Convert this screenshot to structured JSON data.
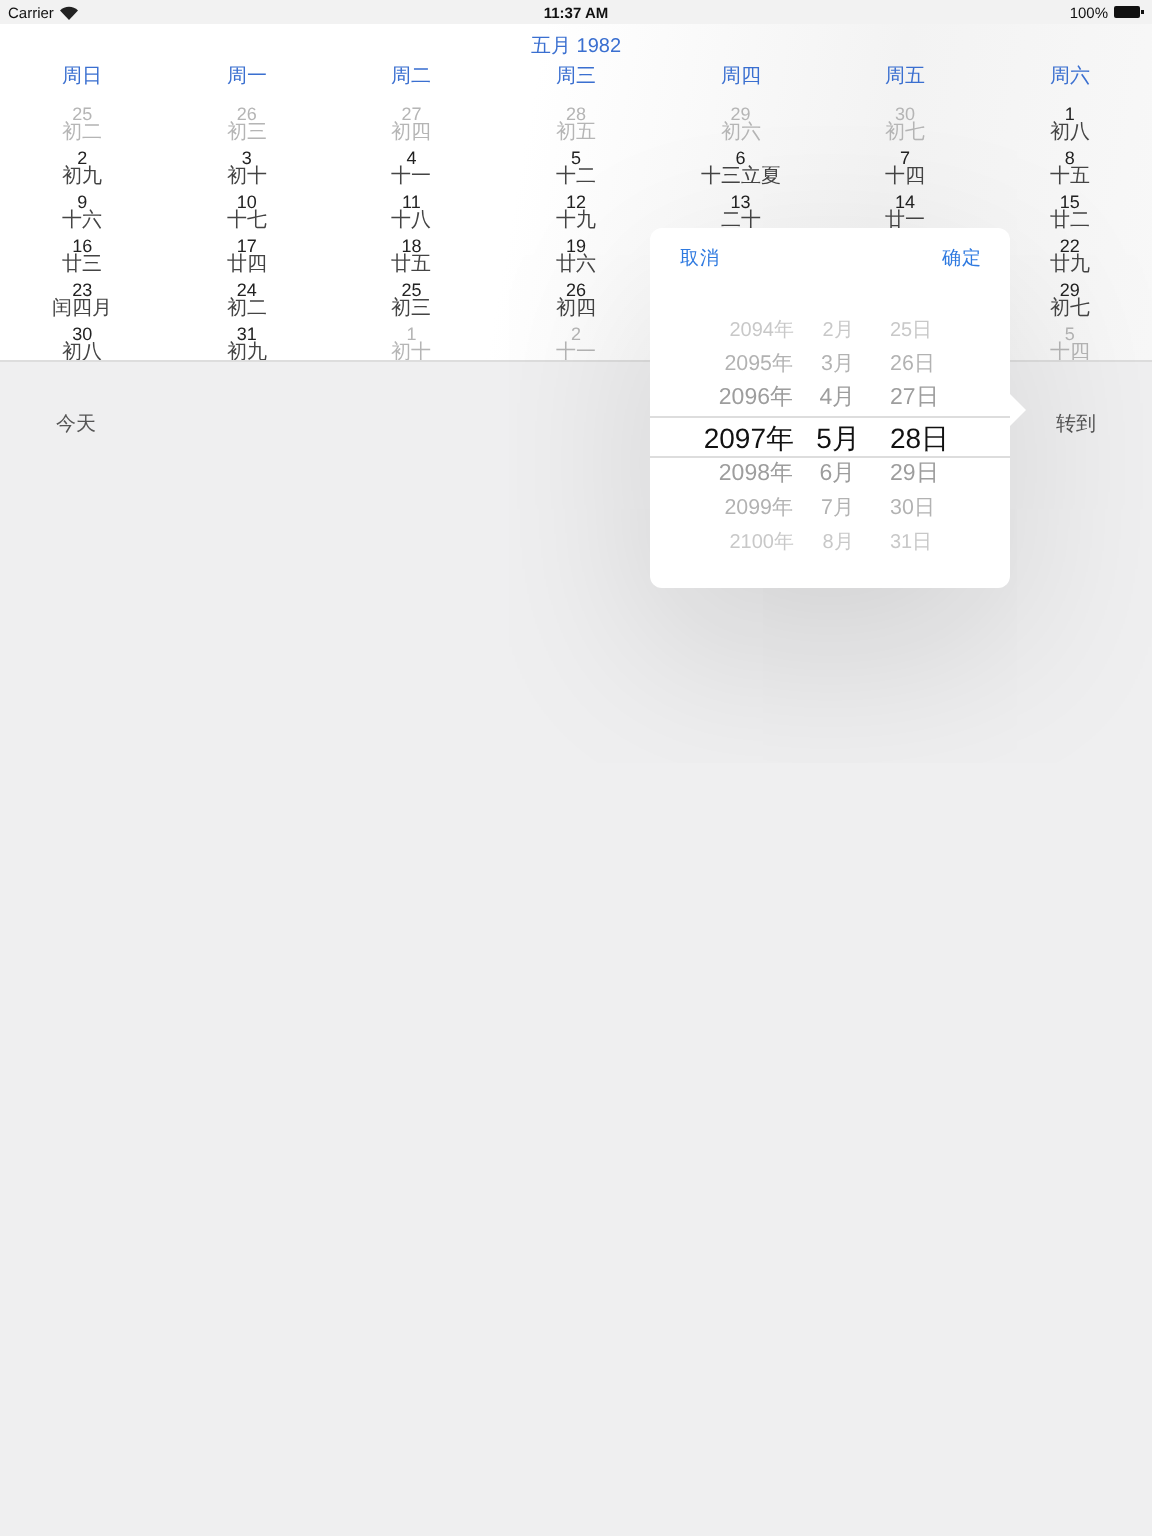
{
  "status_bar": {
    "carrier": "Carrier",
    "time": "11:37 AM",
    "battery": "100%"
  },
  "calendar": {
    "title": "五月 1982",
    "weekdays": [
      "周日",
      "周一",
      "周二",
      "周三",
      "周四",
      "周五",
      "周六"
    ],
    "weeks": [
      [
        {
          "day": "25",
          "lunar": "初二",
          "muted": true
        },
        {
          "day": "26",
          "lunar": "初三",
          "muted": true
        },
        {
          "day": "27",
          "lunar": "初四",
          "muted": true
        },
        {
          "day": "28",
          "lunar": "初五",
          "muted": true
        },
        {
          "day": "29",
          "lunar": "初六",
          "muted": true
        },
        {
          "day": "30",
          "lunar": "初七",
          "muted": true
        },
        {
          "day": "1",
          "lunar": "初八",
          "muted": false
        }
      ],
      [
        {
          "day": "2",
          "lunar": "初九",
          "muted": false
        },
        {
          "day": "3",
          "lunar": "初十",
          "muted": false
        },
        {
          "day": "4",
          "lunar": "十一",
          "muted": false
        },
        {
          "day": "5",
          "lunar": "十二",
          "muted": false
        },
        {
          "day": "6",
          "lunar": "十三立夏",
          "muted": false
        },
        {
          "day": "7",
          "lunar": "十四",
          "muted": false
        },
        {
          "day": "8",
          "lunar": "十五",
          "muted": false
        }
      ],
      [
        {
          "day": "9",
          "lunar": "十六",
          "muted": false
        },
        {
          "day": "10",
          "lunar": "十七",
          "muted": false
        },
        {
          "day": "11",
          "lunar": "十八",
          "muted": false
        },
        {
          "day": "12",
          "lunar": "十九",
          "muted": false
        },
        {
          "day": "13",
          "lunar": "二十",
          "muted": false
        },
        {
          "day": "14",
          "lunar": "廿一",
          "muted": false
        },
        {
          "day": "15",
          "lunar": "廿二",
          "muted": false
        }
      ],
      [
        {
          "day": "16",
          "lunar": "廿三",
          "muted": false
        },
        {
          "day": "17",
          "lunar": "廿四",
          "muted": false
        },
        {
          "day": "18",
          "lunar": "廿五",
          "muted": false
        },
        {
          "day": "19",
          "lunar": "廿六",
          "muted": false
        },
        {
          "day": "22",
          "lunar": "廿九",
          "muted": false
        }
      ],
      [
        {
          "day": "23",
          "lunar": "闰四月",
          "muted": false
        },
        {
          "day": "24",
          "lunar": "初二",
          "muted": false
        },
        {
          "day": "25",
          "lunar": "初三",
          "muted": false
        },
        {
          "day": "26",
          "lunar": "初四",
          "muted": false
        },
        {
          "day": "29",
          "lunar": "初七",
          "muted": false
        }
      ],
      [
        {
          "day": "30",
          "lunar": "初八",
          "muted": false
        },
        {
          "day": "31",
          "lunar": "初九",
          "muted": false
        },
        {
          "day": "1",
          "lunar": "初十",
          "muted": true
        },
        {
          "day": "2",
          "lunar": "十一",
          "muted": true
        },
        {
          "day": "5",
          "lunar": "十四",
          "muted": true
        }
      ]
    ]
  },
  "toolbar": {
    "today": "今天",
    "goto": "转到"
  },
  "popover": {
    "cancel": "取消",
    "confirm": "确定",
    "picker": [
      {
        "year": "2094年",
        "month": "2月",
        "day": "25日",
        "selected": false
      },
      {
        "year": "2095年",
        "month": "3月",
        "day": "26日",
        "selected": false
      },
      {
        "year": "2096年",
        "month": "4月",
        "day": "27日",
        "selected": false
      },
      {
        "year": "2097年",
        "month": "5月",
        "day": "28日",
        "selected": true
      },
      {
        "year": "2098年",
        "month": "6月",
        "day": "29日",
        "selected": false
      },
      {
        "year": "2099年",
        "month": "7月",
        "day": "30日",
        "selected": false
      },
      {
        "year": "2100年",
        "month": "8月",
        "day": "31日",
        "selected": false
      }
    ]
  }
}
